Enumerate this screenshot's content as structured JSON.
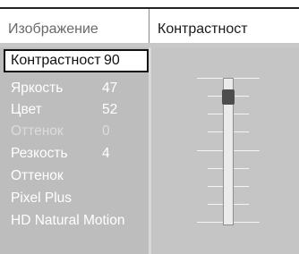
{
  "header": {
    "left_label": "Изображение",
    "right_label": "Контрастност"
  },
  "menu": {
    "items": [
      {
        "label": "Контрастност",
        "value": "90",
        "state": "selected"
      },
      {
        "label": "Яркость",
        "value": "47",
        "state": "normal"
      },
      {
        "label": "Цвет",
        "value": "52",
        "state": "normal"
      },
      {
        "label": "Оттенок",
        "value": "0",
        "state": "disabled"
      },
      {
        "label": "Резкость",
        "value": "4",
        "state": "normal"
      },
      {
        "label": "Оттенок",
        "value": "",
        "state": "normal"
      },
      {
        "label": "Pixel Plus",
        "value": "",
        "state": "normal"
      },
      {
        "label": "HD Natural Motion",
        "value": "",
        "state": "normal"
      }
    ]
  },
  "slider": {
    "label": "Контрастност",
    "value": 90,
    "max": 100
  },
  "colors": {
    "menu_background": "#bdbdbd",
    "panel_background": "#c5c5c5",
    "selected_background": "#ffffff",
    "thumb": "#4d4d4d"
  }
}
